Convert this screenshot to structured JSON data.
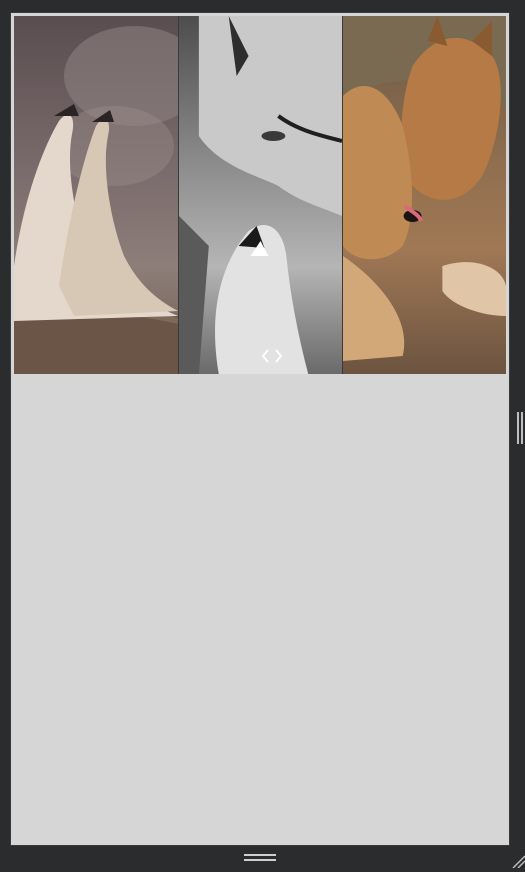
{
  "canvas": {
    "background_color": "#d6d6d6",
    "frame_color": "#2b2c2e"
  },
  "collage": {
    "panels": [
      {
        "icon": "howling-wolves-photo-icon"
      },
      {
        "icon": "grayscale-wolves-photo-icon"
      },
      {
        "icon": "red-wolves-photo-icon"
      }
    ]
  },
  "controls": {
    "swap_icon": "swap-arrows-icon",
    "side_handle_icon": "drag-handle-vertical-icon",
    "bottom_handle_icon": "drag-handle-horizontal-icon",
    "resize_icon": "resize-grip-icon"
  }
}
